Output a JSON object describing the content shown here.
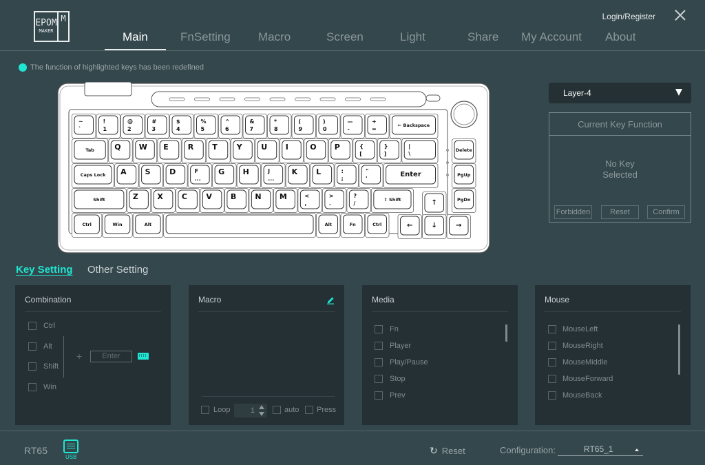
{
  "app": {
    "logo": {
      "top": "EPOM",
      "bottom": "MAKER",
      "side": "M"
    },
    "login_label": "Login/Register"
  },
  "nav": {
    "tabs": [
      {
        "label": "Main",
        "active": true
      },
      {
        "label": "FnSetting",
        "active": false
      },
      {
        "label": "Macro",
        "active": false
      },
      {
        "label": "Screen",
        "active": false
      },
      {
        "label": "Light",
        "active": false
      },
      {
        "label": "Share",
        "active": false
      },
      {
        "label": "My Account",
        "active": false
      },
      {
        "label": "About",
        "active": false
      }
    ]
  },
  "notice": {
    "text": "The function of highlighted keys has been redefined",
    "color": "#1fe6d2"
  },
  "keyboard": {
    "rows": [
      [
        {
          "t": "~",
          "b": "`"
        },
        {
          "t": "!",
          "b": "1"
        },
        {
          "t": "@",
          "b": "2"
        },
        {
          "t": "#",
          "b": "3"
        },
        {
          "t": "$",
          "b": "4"
        },
        {
          "t": "%",
          "b": "5"
        },
        {
          "t": "^",
          "b": "6"
        },
        {
          "t": "&",
          "b": "7"
        },
        {
          "t": "*",
          "b": "8"
        },
        {
          "t": "(",
          "b": "9"
        },
        {
          "t": ")",
          "b": "0"
        },
        {
          "t": "—",
          "b": "-"
        },
        {
          "t": "+",
          "b": "="
        },
        {
          "label": "← Backspace",
          "w": 2
        }
      ],
      [
        {
          "label": "Tab",
          "w": 1.5
        },
        {
          "t": "Q"
        },
        {
          "t": "W"
        },
        {
          "t": "E"
        },
        {
          "t": "R"
        },
        {
          "t": "T"
        },
        {
          "t": "Y"
        },
        {
          "t": "U"
        },
        {
          "t": "I"
        },
        {
          "t": "O"
        },
        {
          "t": "P"
        },
        {
          "t": "{",
          "b": "["
        },
        {
          "t": "}",
          "b": "]"
        },
        {
          "t": "|",
          "b": "\\",
          "w": 1.5
        }
      ],
      [
        {
          "label": "Caps Lock",
          "w": 1.75
        },
        {
          "t": "A"
        },
        {
          "t": "S"
        },
        {
          "t": "D"
        },
        {
          "t": "F",
          "b": "..."
        },
        {
          "t": "G"
        },
        {
          "t": "H"
        },
        {
          "t": "J",
          "b": "..."
        },
        {
          "t": "K"
        },
        {
          "t": "L"
        },
        {
          "t": ":",
          "b": ";"
        },
        {
          "t": "\"",
          "b": "'"
        },
        {
          "label": "Enter",
          "w": 2.25
        }
      ],
      [
        {
          "label": "Shift",
          "w": 2.25
        },
        {
          "t": "Z"
        },
        {
          "t": "X"
        },
        {
          "t": "C"
        },
        {
          "t": "V"
        },
        {
          "t": "B"
        },
        {
          "t": "N"
        },
        {
          "t": "M"
        },
        {
          "t": "<",
          "b": ","
        },
        {
          "t": ">",
          "b": "."
        },
        {
          "t": "?",
          "b": "/"
        },
        {
          "label": "⇧ Shift",
          "w": 1.75
        }
      ],
      [
        {
          "label": "Ctrl",
          "w": 1.25
        },
        {
          "label": "Win",
          "w": 1.25
        },
        {
          "label": "Alt",
          "w": 1.25
        },
        {
          "label": "",
          "w": 6.25
        },
        {
          "label": "Alt"
        },
        {
          "label": "Fn"
        },
        {
          "label": "Ctrl"
        }
      ]
    ],
    "side_keys": [
      "Delete",
      "PgUp",
      "PgDn"
    ],
    "arrows": {
      "up": "↑",
      "left": "←",
      "down": "↓",
      "right": "→"
    }
  },
  "layer": {
    "selected": "Layer-4"
  },
  "current_key_function": {
    "title": "Current Key Function",
    "message_line1": "No Key",
    "message_line2": "Selected",
    "buttons": {
      "forbidden": "Forbidden",
      "reset": "Reset",
      "confirm": "Confirm"
    }
  },
  "setting_tabs": {
    "key_setting": "Key Setting",
    "other_setting": "Other Setting"
  },
  "combination": {
    "title": "Combination",
    "modifiers": [
      "Ctrl",
      "Alt",
      "Shift",
      "Win"
    ],
    "plus": "+",
    "key_placeholder": "Enter"
  },
  "macro": {
    "title": "Macro",
    "loop_label": "Loop",
    "loop_count": "1",
    "auto_label": "auto",
    "press_label": "Press"
  },
  "media": {
    "title": "Media",
    "items": [
      "Fn",
      "Player",
      "Play/Pause",
      "Stop",
      "Prev"
    ]
  },
  "mouse": {
    "title": "Mouse",
    "items": [
      "MouseLeft",
      "MouseRight",
      "MouseMiddle",
      "MouseForward",
      "MouseBack"
    ]
  },
  "footer": {
    "device": "RT65",
    "connection": "USB",
    "reset_label": "Reset",
    "config_label": "Configuration:",
    "config_value": "RT65_1"
  }
}
